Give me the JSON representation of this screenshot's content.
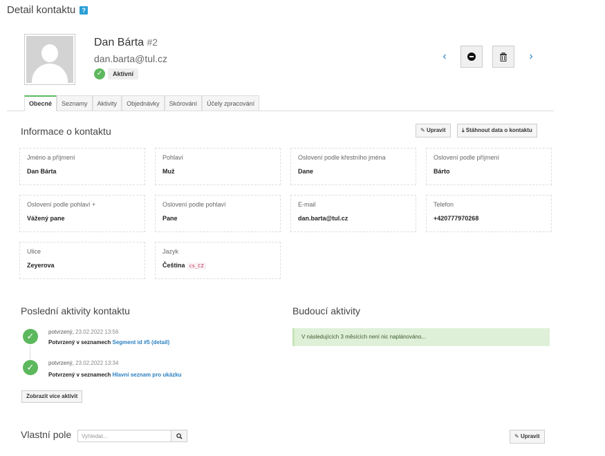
{
  "header": {
    "title": "Detail kontaktu",
    "help": "?"
  },
  "contact": {
    "name": "Dan Bárta",
    "id": "#2",
    "email": "dan.barta@tul.cz",
    "status": "Aktivní"
  },
  "nav": {
    "prev": "‹",
    "next": "›"
  },
  "tabs": [
    "Obecné",
    "Seznamy",
    "Aktivity",
    "Objednávky",
    "Skórování",
    "Účely zpracování"
  ],
  "info": {
    "title": "Informace o kontaktu",
    "edit_label": "Upravit",
    "download_label": "Stáhnout data o kontaktu",
    "fields": [
      {
        "label": "Jméno a příjmení",
        "value": "Dan Bárta"
      },
      {
        "label": "Pohlaví",
        "value": "Muž"
      },
      {
        "label": "Oslovení podle křestního jména",
        "value": "Dane"
      },
      {
        "label": "Oslovení podle příjmení",
        "value": "Bárto"
      },
      {
        "label": "Oslovení podle pohlaví +",
        "value": "Vážený pane"
      },
      {
        "label": "Oslovení podle pohlaví",
        "value": "Pane"
      },
      {
        "label": "E-mail",
        "value": "dan.barta@tul.cz"
      },
      {
        "label": "Telefon",
        "value": "+420777970268"
      },
      {
        "label": "Ulice",
        "value": "Zeyerova"
      },
      {
        "label": "Jazyk",
        "value": "Čeština",
        "code": "cs_CZ"
      }
    ]
  },
  "activities": {
    "title": "Poslední aktivity kontaktu",
    "items": [
      {
        "status": "potvrzený,",
        "date": "23.02.2022 13:56",
        "text": "Potvrzený v seznamech",
        "link": "Segment id #5 (detail)"
      },
      {
        "status": "potvrzený,",
        "date": "23.02.2022 13:34",
        "text": "Potvrzený v seznamech",
        "link": "Hlavní seznam pro ukázku"
      }
    ],
    "more_label": "Zobrazit více aktivit"
  },
  "future": {
    "title": "Budoucí aktivity",
    "message": "V následujících 3 měsících není nic naplánováno..."
  },
  "custom": {
    "title": "Vlastní pole",
    "search_placeholder": "Vyhledat...",
    "edit_label": "Upravit"
  }
}
